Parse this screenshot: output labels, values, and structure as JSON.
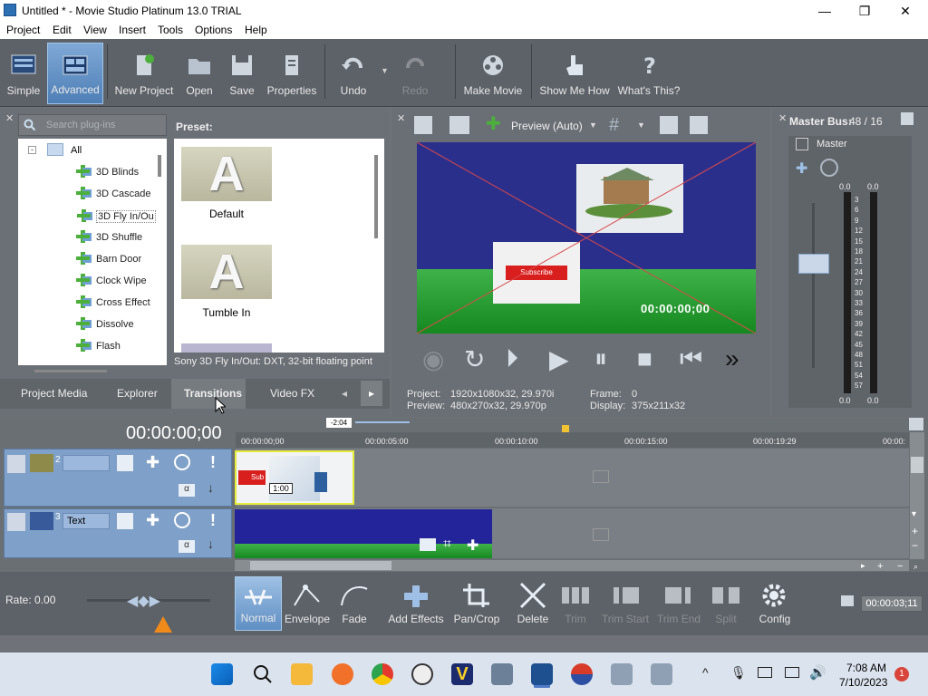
{
  "window": {
    "title": "Untitled * - Movie Studio Platinum 13.0 TRIAL"
  },
  "menu": [
    "Project",
    "Edit",
    "View",
    "Insert",
    "Tools",
    "Options",
    "Help"
  ],
  "toolbar": {
    "simple": "Simple",
    "advanced": "Advanced",
    "new_project": "New Project",
    "open": "Open",
    "save": "Save",
    "properties": "Properties",
    "undo": "Undo",
    "redo": "Redo",
    "make_movie": "Make Movie",
    "show_me_how": "Show Me How",
    "whats_this": "What's This?"
  },
  "plugins": {
    "search_placeholder": "Search plug-ins",
    "root": "All",
    "items": [
      "3D Blinds",
      "3D Cascade",
      "3D Fly In/Ou",
      "3D Shuffle",
      "Barn Door",
      "Clock Wipe",
      "Cross Effect",
      "Dissolve",
      "Flash"
    ]
  },
  "presets": {
    "label": "Preset:",
    "items": [
      {
        "name": "Default",
        "glyph": "A"
      },
      {
        "name": "Tumble In",
        "glyph": "A"
      }
    ],
    "description": "Sony 3D Fly In/Out: DXT, 32-bit floating point"
  },
  "tabs": [
    "Project Media",
    "Explorer",
    "Transitions",
    "Video FX"
  ],
  "preview": {
    "mode": "Preview (Auto)",
    "timecode": "00:00:00;00",
    "subscribe_text": "Subscribe",
    "project_label": "Project:",
    "project_value": "1920x1080x32, 29.970i",
    "preview_label": "Preview:",
    "preview_value": "480x270x32, 29.970p",
    "frame_label": "Frame:",
    "frame_value": "0",
    "display_label": "Display:",
    "display_value": "375x211x32"
  },
  "master": {
    "title": "Master Bus:",
    "value": "48 / 16",
    "label": "Master",
    "peak_l": "0.0",
    "peak_r": "0.0",
    "bottom_l": "0.0",
    "bottom_r": "0.0",
    "scale": [
      "3",
      "6",
      "9",
      "12",
      "15",
      "18",
      "21",
      "24",
      "27",
      "30",
      "33",
      "36",
      "39",
      "42",
      "45",
      "48",
      "51",
      "54",
      "57"
    ]
  },
  "timeline": {
    "timecode": "00:00:00;00",
    "marker": "-2:04",
    "ruler": [
      "00:00:00;00",
      "00:00:05:00",
      "00:00:10:00",
      "00:00:15:00",
      "00:00:19:29",
      "00:00:"
    ],
    "track1_number": "2",
    "track2_number": "3",
    "track2_name": "Text",
    "clip_time": "1:00",
    "clip_sub": "Sub",
    "rate": "Rate: 0.00",
    "end_time": "00:00:03;11"
  },
  "edit_tools": {
    "normal": "Normal",
    "envelope": "Envelope",
    "fade": "Fade",
    "add_effects": "Add Effects",
    "pan_crop": "Pan/Crop",
    "delete": "Delete",
    "trim": "Trim",
    "trim_start": "Trim Start",
    "trim_end": "Trim End",
    "split": "Split",
    "config": "Config"
  },
  "taskbar": {
    "time": "7:08 AM",
    "date": "7/10/2023",
    "badge": "1"
  }
}
